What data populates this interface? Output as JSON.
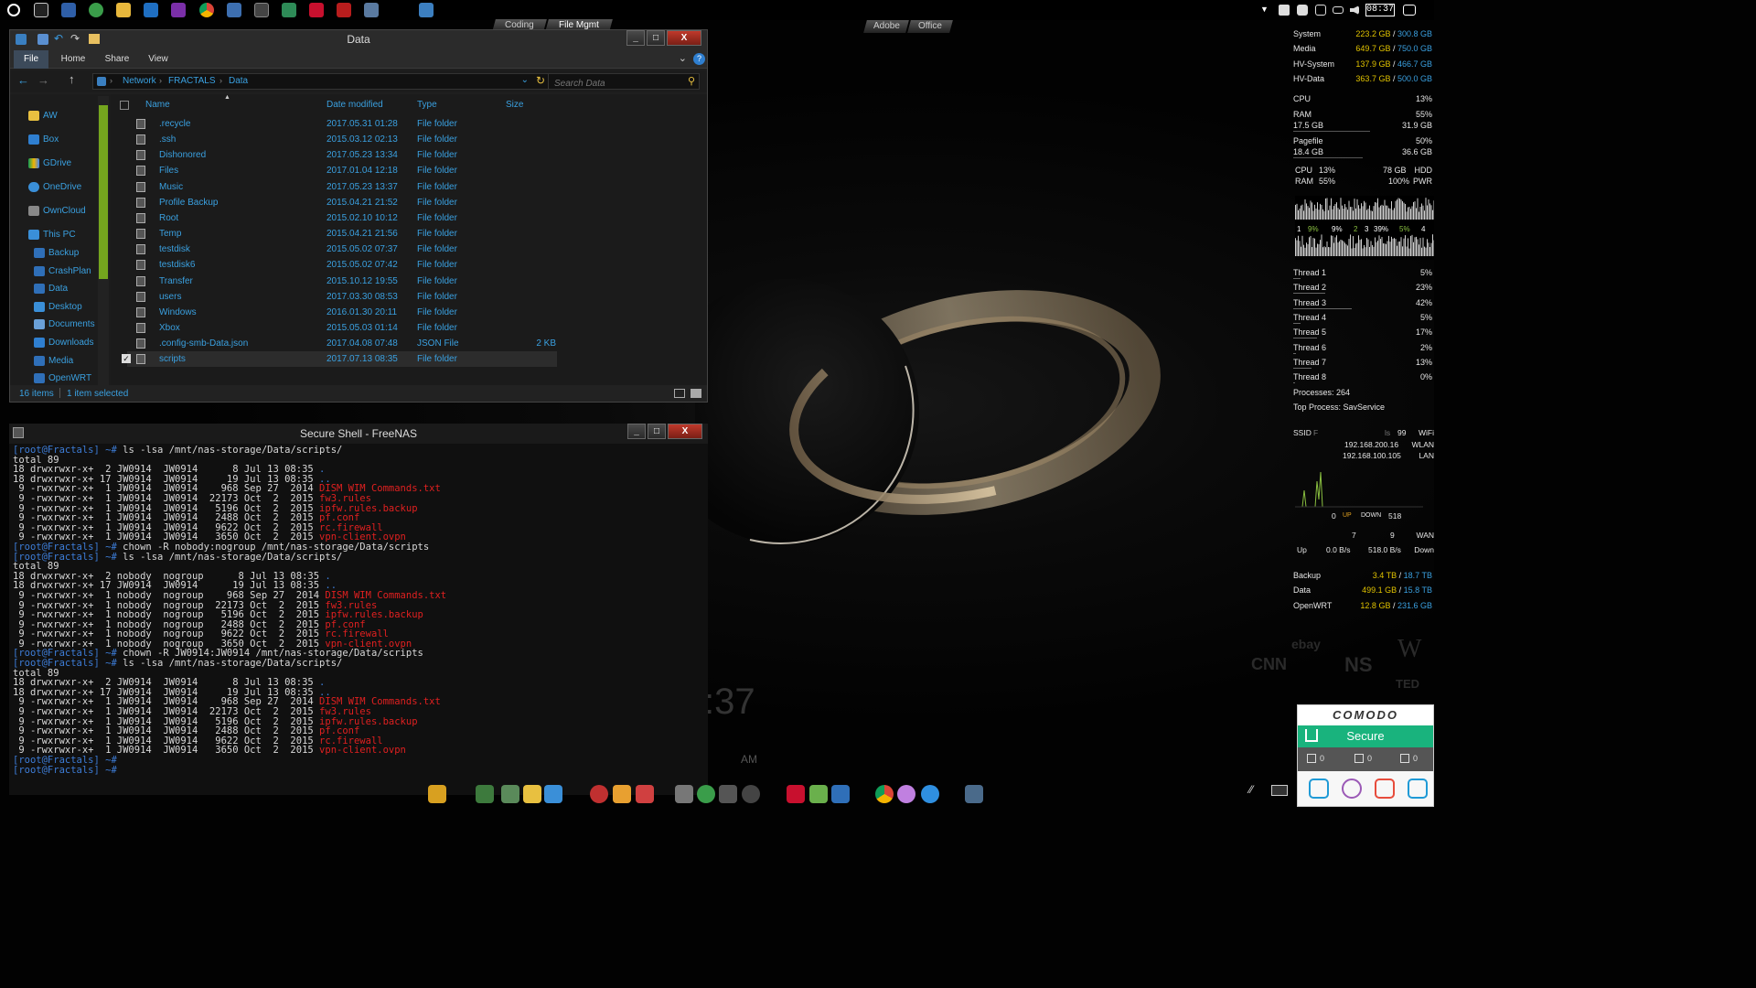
{
  "top_tabs": [
    "Coding",
    "File Mgmt"
  ],
  "desktop_tabs": [
    "Adobe",
    "Office"
  ],
  "tray": {
    "clock": "08:37"
  },
  "explorer": {
    "title": "Data",
    "ribbon_tabs": [
      "File",
      "Home",
      "Share",
      "View"
    ],
    "breadcrumbs": [
      "Network",
      "FRACTALS",
      "Data"
    ],
    "search_placeholder": "Search Data",
    "nav_items": [
      "AW",
      "Box",
      "GDrive",
      "OneDrive",
      "OwnCloud",
      "This PC",
      "Backup",
      "CrashPlan",
      "Data",
      "Desktop",
      "Documents",
      "Downloads",
      "Media",
      "OpenWRT"
    ],
    "columns": [
      "Name",
      "Date modified",
      "Type",
      "Size"
    ],
    "files": [
      {
        "name": ".recycle",
        "date": "2017.05.31 01:28",
        "type": "File folder",
        "size": ""
      },
      {
        "name": ".ssh",
        "date": "2015.03.12 02:13",
        "type": "File folder",
        "size": ""
      },
      {
        "name": "Dishonored",
        "date": "2017.05.23 13:34",
        "type": "File folder",
        "size": ""
      },
      {
        "name": "Files",
        "date": "2017.01.04 12:18",
        "type": "File folder",
        "size": ""
      },
      {
        "name": "Music",
        "date": "2017.05.23 13:37",
        "type": "File folder",
        "size": ""
      },
      {
        "name": "Profile Backup",
        "date": "2015.04.21 21:52",
        "type": "File folder",
        "size": ""
      },
      {
        "name": "Root",
        "date": "2015.02.10 10:12",
        "type": "File folder",
        "size": ""
      },
      {
        "name": "Temp",
        "date": "2015.04.21 21:56",
        "type": "File folder",
        "size": ""
      },
      {
        "name": "testdisk",
        "date": "2015.05.02 07:37",
        "type": "File folder",
        "size": ""
      },
      {
        "name": "testdisk6",
        "date": "2015.05.02 07:42",
        "type": "File folder",
        "size": ""
      },
      {
        "name": "Transfer",
        "date": "2015.10.12 19:55",
        "type": "File folder",
        "size": ""
      },
      {
        "name": "users",
        "date": "2017.03.30 08:53",
        "type": "File folder",
        "size": ""
      },
      {
        "name": "Windows",
        "date": "2016.01.30 20:11",
        "type": "File folder",
        "size": ""
      },
      {
        "name": "Xbox",
        "date": "2015.05.03 01:14",
        "type": "File folder",
        "size": ""
      },
      {
        "name": ".config-smb-Data.json",
        "date": "2017.04.08 07:48",
        "type": "JSON File",
        "size": "2 KB"
      },
      {
        "name": "scripts",
        "date": "2017.07.13 08:35",
        "type": "File folder",
        "size": "",
        "selected": true
      }
    ],
    "status_items": "16 items",
    "status_selected": "1 item selected"
  },
  "terminal": {
    "title": "Secure Shell - FreeNAS",
    "prompt": "[root@Fractals] ~#",
    "lines": [
      {
        "p": "[root@Fractals] ~#",
        "t": " ls -lsa /mnt/nas-storage/Data/scripts/"
      },
      {
        "t": "total 89"
      },
      {
        "t": "18 drwxrwxr-x+  2 JW0914  JW0914      8 Jul 13 08:35 ",
        "b": "."
      },
      {
        "t": "18 drwxrwxr-x+ 17 JW0914  JW0914     19 Jul 13 08:35 ",
        "b": ".."
      },
      {
        "t": " 9 -rwxrwxr-x+  1 JW0914  JW0914    968 Sep 27  2014 ",
        "r": "DISM WIM Commands.txt"
      },
      {
        "t": " 9 -rwxrwxr-x+  1 JW0914  JW0914  22173 Oct  2  2015 ",
        "r": "fw3.rules"
      },
      {
        "t": " 9 -rwxrwxr-x+  1 JW0914  JW0914   5196 Oct  2  2015 ",
        "r": "ipfw.rules.backup"
      },
      {
        "t": " 9 -rwxrwxr-x+  1 JW0914  JW0914   2488 Oct  2  2015 ",
        "r": "pf.conf"
      },
      {
        "t": " 9 -rwxrwxr-x+  1 JW0914  JW0914   9622 Oct  2  2015 ",
        "r": "rc.firewall"
      },
      {
        "t": " 9 -rwxrwxr-x+  1 JW0914  JW0914   3650 Oct  2  2015 ",
        "r": "vpn-client.ovpn"
      },
      {
        "p": "[root@Fractals] ~#",
        "t": " chown -R nobody:nogroup /mnt/nas-storage/Data/scripts"
      },
      {
        "p": "[root@Fractals] ~#",
        "t": " ls -lsa /mnt/nas-storage/Data/scripts/"
      },
      {
        "t": "total 89"
      },
      {
        "t": "18 drwxrwxr-x+  2 nobody  nogroup      8 Jul 13 08:35 ",
        "b": "."
      },
      {
        "t": "18 drwxrwxr-x+ 17 JW0914  JW0914      19 Jul 13 08:35 ",
        "b": ".."
      },
      {
        "t": " 9 -rwxrwxr-x+  1 nobody  nogroup    968 Sep 27  2014 ",
        "r": "DISM WIM Commands.txt"
      },
      {
        "t": " 9 -rwxrwxr-x+  1 nobody  nogroup  22173 Oct  2  2015 ",
        "r": "fw3.rules"
      },
      {
        "t": " 9 -rwxrwxr-x+  1 nobody  nogroup   5196 Oct  2  2015 ",
        "r": "ipfw.rules.backup"
      },
      {
        "t": " 9 -rwxrwxr-x+  1 nobody  nogroup   2488 Oct  2  2015 ",
        "r": "pf.conf"
      },
      {
        "t": " 9 -rwxrwxr-x+  1 nobody  nogroup   9622 Oct  2  2015 ",
        "r": "rc.firewall"
      },
      {
        "t": " 9 -rwxrwxr-x+  1 nobody  nogroup   3650 Oct  2  2015 ",
        "r": "vpn-client.ovpn"
      },
      {
        "p": "[root@Fractals] ~#",
        "t": " chown -R JW0914:JW0914 /mnt/nas-storage/Data/scripts"
      },
      {
        "p": "[root@Fractals] ~#",
        "t": " ls -lsa /mnt/nas-storage/Data/scripts/"
      },
      {
        "t": "total 89"
      },
      {
        "t": "18 drwxrwxr-x+  2 JW0914  JW0914      8 Jul 13 08:35 ",
        "b": "."
      },
      {
        "t": "18 drwxrwxr-x+ 17 JW0914  JW0914     19 Jul 13 08:35 ",
        "b": ".."
      },
      {
        "t": " 9 -rwxrwxr-x+  1 JW0914  JW0914    968 Sep 27  2014 ",
        "r": "DISM WIM Commands.txt"
      },
      {
        "t": " 9 -rwxrwxr-x+  1 JW0914  JW0914  22173 Oct  2  2015 ",
        "r": "fw3.rules"
      },
      {
        "t": " 9 -rwxrwxr-x+  1 JW0914  JW0914   5196 Oct  2  2015 ",
        "r": "ipfw.rules.backup"
      },
      {
        "t": " 9 -rwxrwxr-x+  1 JW0914  JW0914   2488 Oct  2  2015 ",
        "r": "pf.conf"
      },
      {
        "t": " 9 -rwxrwxr-x+  1 JW0914  JW0914   9622 Oct  2  2015 ",
        "r": "rc.firewall"
      },
      {
        "t": " 9 -rwxrwxr-x+  1 JW0914  JW0914   3650 Oct  2  2015 ",
        "r": "vpn-client.ovpn"
      },
      {
        "p": "[root@Fractals] ~#",
        "t": ""
      },
      {
        "p": "[root@Fractals] ~#",
        "t": ""
      }
    ]
  },
  "desktop_clock": {
    "time": ":37",
    "ampm": "AM"
  },
  "monitor": {
    "drives": [
      {
        "label": "System",
        "used": "223.2 GB",
        "total": "300.8 GB"
      },
      {
        "label": "Media",
        "used": "649.7 GB",
        "total": "750.0 GB"
      },
      {
        "label": "HV-System",
        "used": "137.9 GB",
        "total": "466.7 GB"
      },
      {
        "label": "HV-Data",
        "used": "363.7 GB",
        "total": "500.0 GB"
      }
    ],
    "cpu": {
      "label": "CPU",
      "value": "13%"
    },
    "ram": {
      "label": "RAM",
      "value": "55%",
      "used": "17.5 GB",
      "total": "31.9 GB"
    },
    "pagefile": {
      "label": "Pagefile",
      "value": "50%",
      "used": "18.4 GB",
      "total": "36.6 GB"
    },
    "mini": {
      "cpu_label": "CPU",
      "cpu_val": "13%",
      "hdd_size": "78 GB",
      "hdd_label": "HDD",
      "ram_label": "RAM",
      "ram_val": "55%",
      "pwr_val": "100%",
      "pwr_label": "PWR"
    },
    "graph_labels": [
      "1",
      "9%",
      "9%",
      "2",
      "3",
      "39%",
      "5%",
      "4"
    ],
    "threads": [
      {
        "label": "Thread 1",
        "value": "5%"
      },
      {
        "label": "Thread 2",
        "value": "23%"
      },
      {
        "label": "Thread 3",
        "value": "42%"
      },
      {
        "label": "Thread 4",
        "value": "5%"
      },
      {
        "label": "Thread 5",
        "value": "17%"
      },
      {
        "label": "Thread 6",
        "value": "2%"
      },
      {
        "label": "Thread 7",
        "value": "13%"
      },
      {
        "label": "Thread 8",
        "value": "0%"
      }
    ],
    "processes": "Processes: 264",
    "top_process": "Top Process: SavService",
    "net": {
      "ssid_label": "SSID",
      "ssid_val": "F",
      "ls": "ls",
      "signal": "99",
      "wifi": "WiFi",
      "wlan_ip": "192.168.200.16",
      "wlan": "WLAN",
      "lan_ip": "192.168.100.105",
      "lan": "LAN",
      "up_zero": "0",
      "up_label": "UP",
      "down_label": "DOWN",
      "down_val": "518",
      "n7": "7",
      "n9": "9",
      "wan": "WAN",
      "up": "Up",
      "up_rate": "0.0 B/s",
      "down_rate": "518.0 B/s",
      "down": "Down"
    },
    "nas": [
      {
        "label": "Backup",
        "used": "3.4 TB",
        "total": "18.7 TB"
      },
      {
        "label": "Data",
        "used": "499.1 GB",
        "total": "15.8 TB"
      },
      {
        "label": "OpenWRT",
        "used": "12.8 GB",
        "total": "231.6 GB"
      }
    ]
  },
  "brands": [
    "ebay",
    "CNN",
    "NS",
    "W",
    "TED"
  ],
  "comodo": {
    "brand": "COMODO",
    "status": "Secure",
    "stats": [
      "0",
      "0",
      "0"
    ]
  }
}
